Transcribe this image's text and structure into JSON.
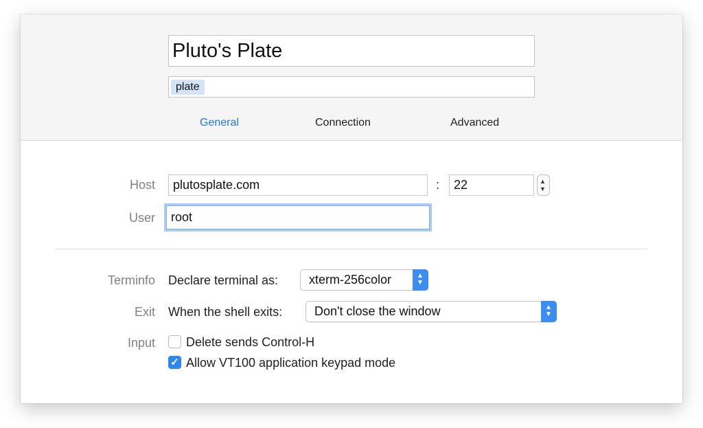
{
  "header": {
    "title_value": "Pluto's Plate",
    "tags": [
      "plate"
    ],
    "tabs": [
      {
        "label": "General",
        "active": true
      },
      {
        "label": "Connection",
        "active": false
      },
      {
        "label": "Advanced",
        "active": false
      }
    ]
  },
  "connection": {
    "host_label": "Host",
    "host_value": "plutosplate.com",
    "port_separator": ":",
    "port_value": "22",
    "user_label": "User",
    "user_value": "root"
  },
  "terminal": {
    "terminfo_label": "Terminfo",
    "declare_label": "Declare terminal as:",
    "declare_value": "xterm-256color",
    "exit_label": "Exit",
    "shell_exits_label": "When the shell exits:",
    "shell_exits_value": "Don't close the window",
    "input_label": "Input",
    "checkboxes": [
      {
        "label": "Delete sends Control-H",
        "checked": false
      },
      {
        "label": "Allow VT100 application keypad mode",
        "checked": true
      }
    ]
  },
  "colors": {
    "accent": "#1f78e5",
    "checkbox_on": "#2e86ef",
    "tag_bg": "#d3e3f8"
  },
  "icons": {
    "stepper": "up-down-chevron-icon",
    "popup": "up-down-chevron-icon",
    "check": "checkmark-icon"
  }
}
